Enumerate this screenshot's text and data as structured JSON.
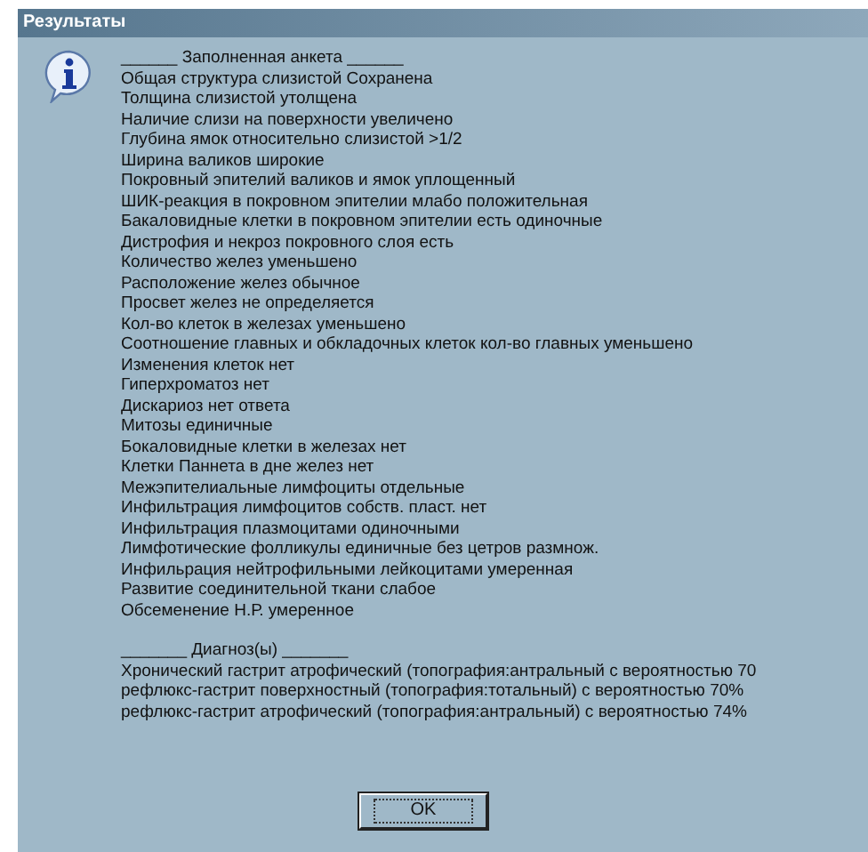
{
  "window": {
    "title": "Результаты"
  },
  "questionnaire": {
    "heading": "______ Заполненная анкета ______",
    "findings": [
      "Общая структура слизистой Сохранена",
      "Толщина слизистой утолщена",
      "Наличие слизи на поверхности увеличено",
      "Глубина ямок относительно слизистой >1/2",
      "Ширина валиков широкие",
      "Покровный эпителий валиков и ямок уплощенный",
      "ШИК-реакция в покровном эпителии млабо положительная",
      "Бакаловидные клетки в покровном эпителии есть одиночные",
      "Дистрофия и некроз покровного слоя есть",
      "Количество желез уменьшено",
      "Расположение желез обычное",
      "Просвет желез не определяется",
      "Кол-во клеток в железах уменьшено",
      "Соотношение главных и обкладочных клеток кол-во главных уменьшено",
      "Изменения клеток нет",
      "Гиперхроматоз нет",
      "Дискариоз нет ответа",
      "Митозы единичные",
      "Бокаловидные клетки в железах нет",
      "Клетки Паннета в дне желез нет",
      "Межэпителиальные лимфоциты отдельные",
      "Инфильтрация лимфоцитов собств. пласт. нет",
      "Инфильтрация плазмоцитами одиночными",
      "Лимфотические фолликулы единичные без цетров размнож.",
      "Инфильрация нейтрофильными лейкоцитами умеренная",
      "Развитие соединительной ткани слабое",
      "Обсеменение Н.Р. умеренное"
    ]
  },
  "diagnoses": {
    "heading": "_______ Диагноз(ы) _______",
    "items": [
      "Хронический гастрит атрофический  (топография:антральный с вероятностью 70",
      "рефлюкс-гастрит поверхностный (топография:тотальный) с вероятностью 70%",
      "рефлюкс-гастрит атрофический  (топография:антральный) с вероятностью 74%"
    ]
  },
  "buttons": [
    "OK"
  ]
}
